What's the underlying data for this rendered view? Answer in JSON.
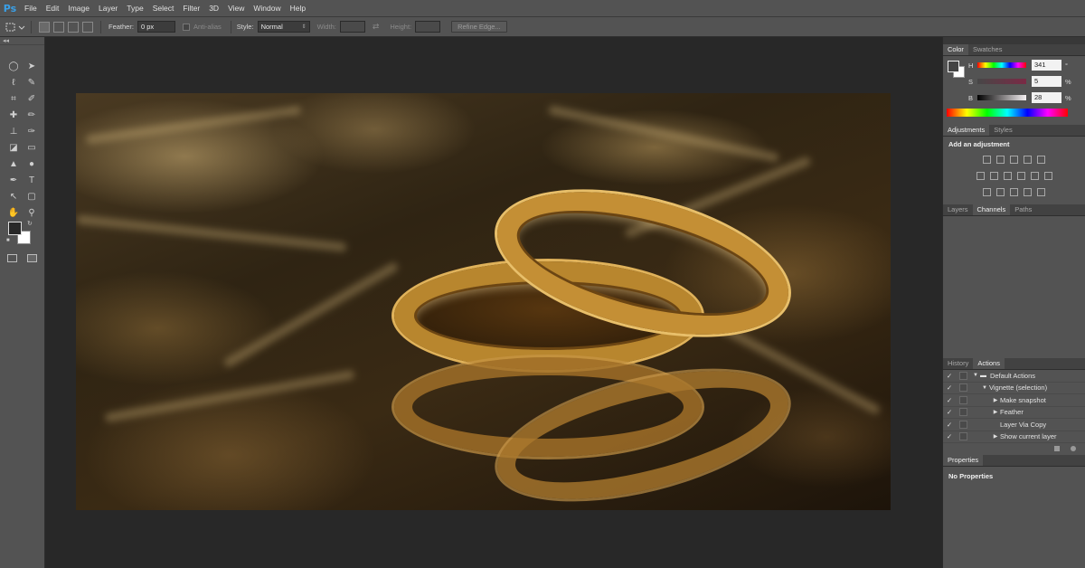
{
  "app": {
    "logo": "Ps"
  },
  "menu": [
    "File",
    "Edit",
    "Image",
    "Layer",
    "Type",
    "Select",
    "Filter",
    "3D",
    "View",
    "Window",
    "Help"
  ],
  "options": {
    "feather_label": "Feather:",
    "feather_value": "0 px",
    "antialias_label": "Anti-alias",
    "style_label": "Style:",
    "style_value": "Normal",
    "width_label": "Width:",
    "height_label": "Height:",
    "refine_label": "Refine Edge..."
  },
  "toolbox": {
    "collapse_glyph": "◂◂"
  },
  "panels": {
    "color": {
      "tabs": [
        "Color",
        "Swatches"
      ],
      "h": {
        "label": "H",
        "value": "341",
        "unit": "°"
      },
      "s": {
        "label": "S",
        "value": "5",
        "unit": "%"
      },
      "b": {
        "label": "B",
        "value": "28",
        "unit": "%"
      }
    },
    "adjustments": {
      "tabs": [
        "Adjustments",
        "Styles"
      ],
      "title": "Add an adjustment"
    },
    "layers": {
      "tabs": [
        "Layers",
        "Channels",
        "Paths"
      ]
    },
    "actions": {
      "tabs": [
        "History",
        "Actions"
      ],
      "rows": [
        {
          "label": "Default Actions",
          "indent": 0
        },
        {
          "label": "Vignette (selection)",
          "indent": 1
        },
        {
          "label": "Make snapshot",
          "indent": 2
        },
        {
          "label": "Feather",
          "indent": 2
        },
        {
          "label": "Layer Via Copy",
          "indent": 2
        },
        {
          "label": "Show current layer",
          "indent": 2
        }
      ]
    },
    "properties": {
      "tabs": [
        "Properties"
      ],
      "empty_text": "No Properties"
    }
  }
}
